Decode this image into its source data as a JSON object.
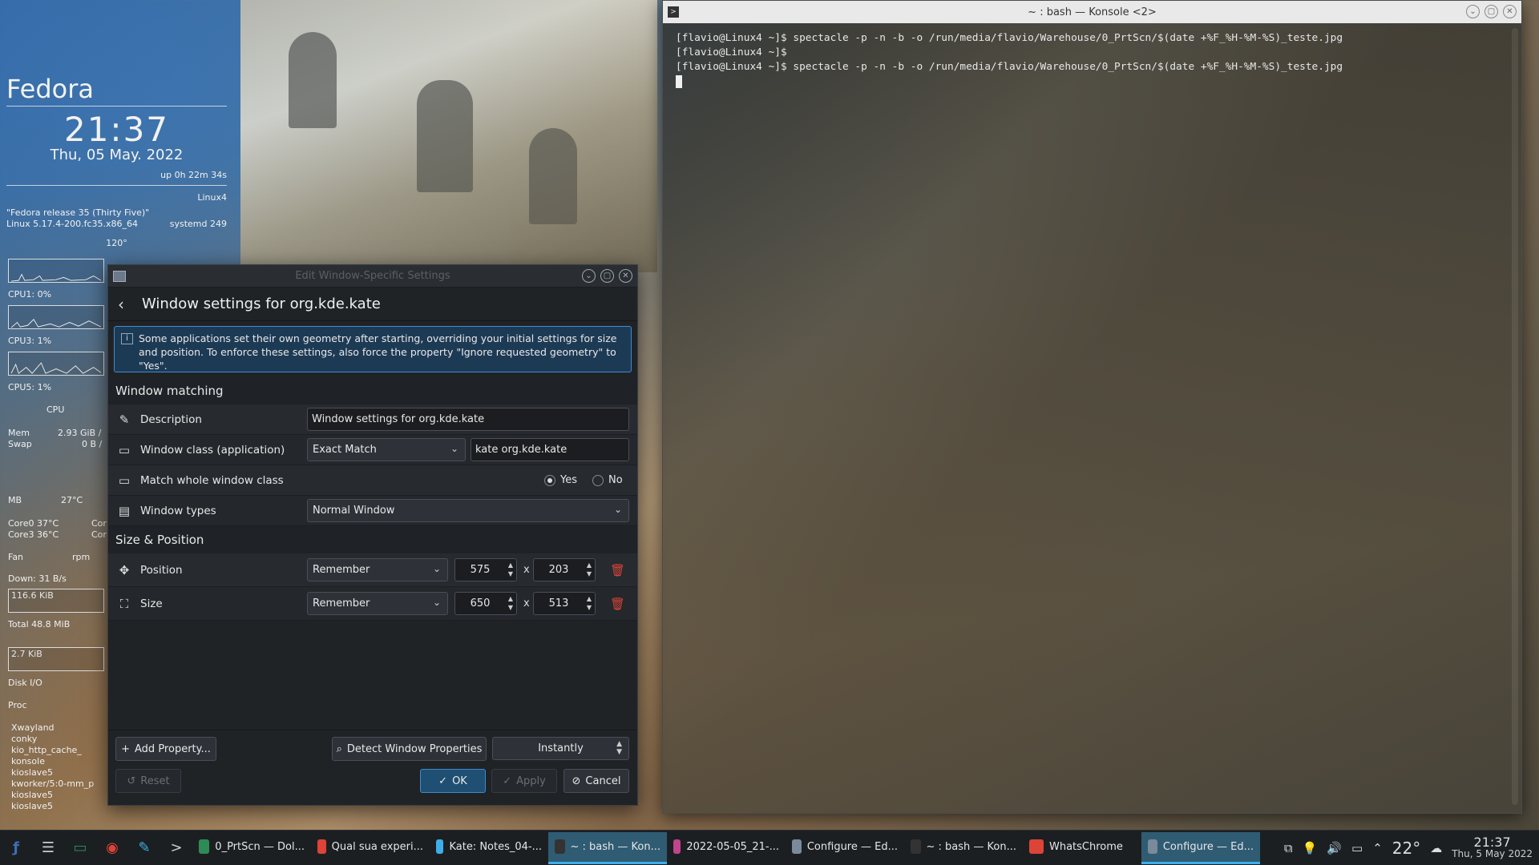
{
  "colors": {
    "accent": "#3daee9",
    "danger": "#d9443a",
    "panel": "#202326",
    "info_bg": "#1d3a55"
  },
  "conky": {
    "os": "Fedora",
    "time": "21:37",
    "date": "Thu, 05 May. 2022",
    "uptime": "up  0h 22m 34s",
    "host": "Linux4",
    "release": "\"Fedora release 35 (Thirty Five)\"",
    "kernel": "Linux 5.17.4-200.fc35.x86_64",
    "systemd": "systemd 249",
    "angle": "120°",
    "cpu1": "CPU1: 0%",
    "cpu3": "CPU3: 1%",
    "cpu5": "CPU5: 1%",
    "cpu_label": "CPU",
    "mem_label": "Mem",
    "mem_val": "2.93 GiB /",
    "swap_label": "Swap",
    "swap_val": "0 B /",
    "mb_label": "MB",
    "mb_temp": "27°C",
    "core0": "Core0  37°C",
    "core3": "Core3  36°C",
    "core_right1": "Cor",
    "core_right2": "Cor",
    "fan": "Fan",
    "rpm": "rpm",
    "down": "Down: 31 B/s",
    "down_graph": "116.6 KiB",
    "total": "Total 48.8 MiB",
    "up_graph": "2.7 KiB",
    "diskio": "Disk I/O",
    "proc": "Proc",
    "processes": [
      "Xwayland",
      "conky",
      "kio_http_cache_",
      "konsole",
      "kioslave5",
      "kworker/5:0-mm_p",
      "kioslave5",
      "kioslave5"
    ]
  },
  "dialog": {
    "window_title": "Edit Window-Specific Settings",
    "header_title": "Window settings for org.kde.kate",
    "info_text": "Some applications set their own geometry after starting, overriding your initial settings for size and position. To enforce these settings, also force the property \"Ignore requested geometry\" to \"Yes\".",
    "section_matching": "Window matching",
    "description_label": "Description",
    "description_value": "Window settings for org.kde.kate",
    "class_label": "Window class (application)",
    "class_match": "Exact Match",
    "class_value": "kate org.kde.kate",
    "whole_label": "Match whole window class",
    "yes": "Yes",
    "no": "No",
    "types_label": "Window types",
    "types_value": "Normal Window",
    "section_size": "Size & Position",
    "position_label": "Position",
    "position_rule": "Remember",
    "position_x": "575",
    "position_y": "203",
    "size_label": "Size",
    "size_rule": "Remember",
    "size_w": "650",
    "size_h": "513",
    "times": "x",
    "add_property": "Add Property...",
    "detect": "Detect Window Properties",
    "instantly": "Instantly",
    "reset": "Reset",
    "ok": "OK",
    "apply": "Apply",
    "cancel": "Cancel"
  },
  "konsole": {
    "title": "~ : bash — Konsole <2>",
    "lines": [
      "[flavio@Linux4 ~]$ spectacle -p -n -b -o /run/media/flavio/Warehouse/0_PrtScn/$(date +%F_%H-%M-%S)_teste.jpg",
      "[flavio@Linux4 ~]$",
      "[flavio@Linux4 ~]$ spectacle -p -n -b -o /run/media/flavio/Warehouse/0_PrtScn/$(date +%F_%H-%M-%S)_teste.jpg"
    ]
  },
  "taskbar": {
    "tasks": [
      {
        "label": "0_PrtScn — Dol...",
        "icon": "folder-icon",
        "color": "#2e8b57"
      },
      {
        "label": "Qual sua experi...",
        "icon": "chrome-icon",
        "color": "#db4437"
      },
      {
        "label": "Kate: Notes_04-...",
        "icon": "kate-icon",
        "color": "#3daee9"
      },
      {
        "label": "~ : bash — Kon...",
        "icon": "terminal-icon",
        "color": "#333333"
      },
      {
        "label": "2022-05-05_21-...",
        "icon": "image-viewer-icon",
        "color": "#c0458a"
      },
      {
        "label": "Configure — Ed...",
        "icon": "settings-window-icon",
        "color": "#7a8a9a"
      },
      {
        "label": "~ : bash — Kon...",
        "icon": "terminal-icon",
        "color": "#333333"
      },
      {
        "label": "WhatsChrome",
        "icon": "chrome-icon",
        "color": "#db4437"
      },
      {
        "label": "Configure — Ed...",
        "icon": "settings-window-icon",
        "color": "#7a8a9a"
      }
    ],
    "active_index": 3,
    "active2_index": 8,
    "temperature": "22°",
    "clock_time": "21:37",
    "clock_date": "Thu, 5 May 2022"
  }
}
